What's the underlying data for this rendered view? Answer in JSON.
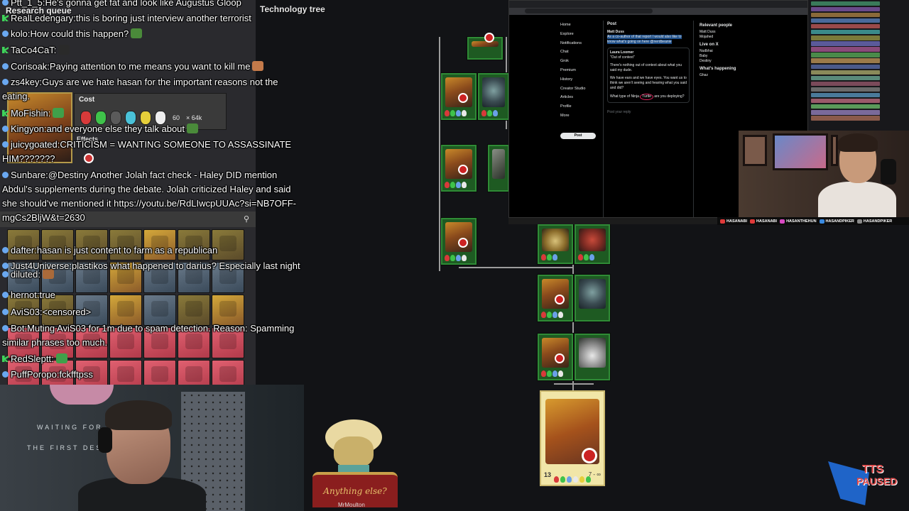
{
  "game": {
    "research_title": "Research queue",
    "tech_title": "Technology tree",
    "cost_label": "Cost",
    "effects_label": "Effects",
    "cost_time": "60",
    "cost_count": "× 64k",
    "selected_level": "13",
    "selected_time": "7 - ∞",
    "character_caption": "Anything else?",
    "character_name": "MrMoulton"
  },
  "chat": {
    "messages": [
      {
        "user": "Ptt_1_5",
        "badge": "blue",
        "text": "He's gonna get fat and look like Augustus Gloop"
      },
      {
        "user": "RealLedengary",
        "badge": "green",
        "text": "this is boring just interview another terrorist"
      },
      {
        "user": "kolo",
        "badge": "blue",
        "text": "How could this happen?"
      },
      {
        "user": "TaCo4CaT",
        "badge": "green",
        "text": ""
      },
      {
        "user": "Corisoak",
        "badge": "blue",
        "text": "Paying attention to me means you want to kill me"
      },
      {
        "user": "zs4key",
        "badge": "blue",
        "text": "Guys are we hate hasan for the important reasons not the eating."
      },
      {
        "user": "MoFishin",
        "badge": "green",
        "text": ""
      },
      {
        "user": "Kingyon",
        "badge": "blue",
        "text": "and everyone else they talk about"
      },
      {
        "user": "juicygoated",
        "badge": "blue",
        "text": "CRITICISM = WANTING SOMEONE TO ASSASSINATE HIM???????"
      },
      {
        "user": "Sunbare",
        "badge": "blue",
        "text": "@Destiny Another Jolah fact check - Haley DID mention Abdul's supplements during the debate. Jolah criticized Haley and said she should've mentioned it https://youtu.be/RdLIwcpUUAc?si=NB7OFF-mgCs2BljW&t=2630"
      },
      {
        "user": "diluted",
        "badge": "blue",
        "text": ""
      },
      {
        "user": "dafter",
        "badge": "blue",
        "text": "hasan is just content to farm as a republican"
      },
      {
        "user": "Just4Universe",
        "badge": "blue",
        "text": "plastikos what happened to darius? Especially last night"
      },
      {
        "user": "hernot",
        "badge": "blue",
        "text": "true"
      },
      {
        "user": "AviS03",
        "badge": "blue",
        "text": "<censored>"
      },
      {
        "user": "Bot",
        "badge": "blue",
        "text": "Muting AviS03 for 1m due to spam detection. Reason: Spamming similar phrases too much."
      },
      {
        "user": "RedSleptt",
        "badge": "green",
        "text": ""
      },
      {
        "user": "PuffPoropo",
        "badge": "blue",
        "text": "fckfftpss"
      }
    ]
  },
  "browser": {
    "nav": [
      "Home",
      "Explore",
      "Notifications",
      "Chat",
      "Grok",
      "Premium",
      "History",
      "Creator Studio",
      "Articles",
      "Profile",
      "More"
    ],
    "post_button": "Post",
    "post_header": "Post",
    "author": "Matt Duss",
    "post_body": "As a co-author of that report I would also like to know what's going on here @nerdbeanie",
    "quote_author": "Laura Loomer",
    "quote_text": "\"Out of context\"",
    "reply1": "There's nothing out of context about what you said my dude.",
    "reply2": "We have ears and we have eyes. You want us to think we aren't seeing and hearing what you said and did?",
    "reply3_prefix": "What type of Ninja",
    "reply3_circled": "Turtle",
    "reply3_suffix": "are you deploying?",
    "reply_placeholder": "Post your reply",
    "relevant_people": "Relevant people",
    "live_on_x": "Live on X",
    "whats_happening": "What's happening",
    "side_names": [
      "Matt Duss",
      "Mojahed",
      "Nudbhai",
      "Baby",
      "Destiny",
      "Ghaz"
    ]
  },
  "social": {
    "handles": [
      "HASANABI",
      "HASANABI",
      "HASANTHEHUN",
      "HASANDPIKER",
      "HASANDPIKER"
    ],
    "colors": [
      "#e03a3a",
      "#e03a3a",
      "#d94ac4",
      "#3a8ae0",
      "#8a8a8a"
    ]
  },
  "tts": {
    "line1": "TTS",
    "line2": "PAUSED",
    "accent": "#e04a4a"
  },
  "cam_left_sign": {
    "line1": "WAITING FOR",
    "line2": "THE FIRST DESI"
  }
}
